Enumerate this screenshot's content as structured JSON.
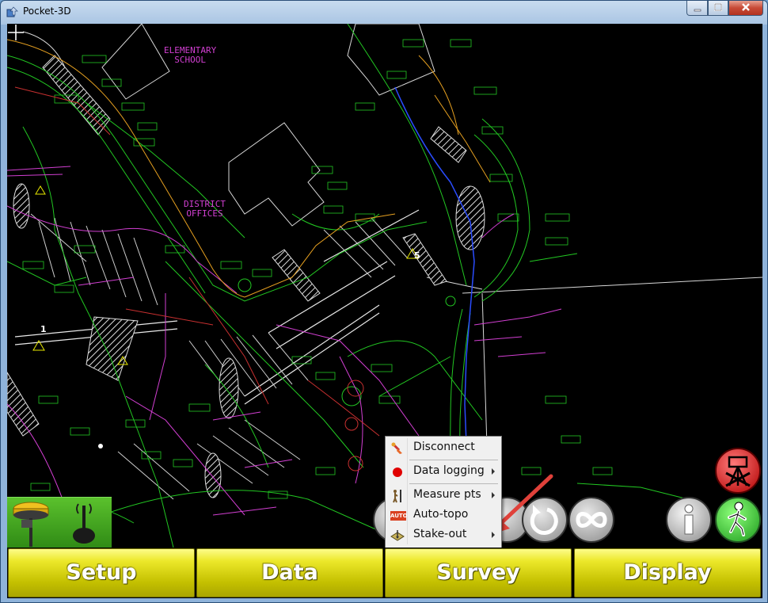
{
  "window": {
    "title": "Pocket-3D",
    "controls": [
      "minimize-icon",
      "maximize-icon",
      "close-icon"
    ]
  },
  "map": {
    "labels": {
      "school": [
        "ELEMENTARY",
        "SCHOOL"
      ],
      "offices": [
        "DISTRICT",
        "OFFICES"
      ],
      "point_1": "1",
      "point_5": "5"
    },
    "colors": {
      "background": "#000000",
      "green": "#22c722",
      "magenta": "#d23fd2",
      "orange": "#e6a020",
      "blue": "#2a4cff",
      "white": "#e8e8e8"
    }
  },
  "instrument_panel": {
    "icons": [
      "rover-receiver-icon",
      "base-antenna-icon"
    ]
  },
  "round_buttons": [
    {
      "name": "rotate-button",
      "icon": "rotate-icon"
    },
    {
      "name": "infinity-button",
      "icon": "infinity-icon"
    },
    {
      "name": "info-button",
      "icon": "info-icon"
    },
    {
      "name": "walk-mode-button",
      "icon": "walking-person-icon"
    },
    {
      "name": "disconnected-status-button",
      "icon": "no-tripod-icon"
    }
  ],
  "context_menu": {
    "items": [
      {
        "label": "Disconnect",
        "icon": "disconnect-icon",
        "submenu": false
      },
      {
        "label": "Data logging",
        "icon": "red-dot-icon",
        "submenu": true
      },
      {
        "label": "Measure pts",
        "icon": "measure-rod-icon",
        "submenu": true
      },
      {
        "label": "Auto-topo",
        "icon": "auto-icon",
        "submenu": false
      },
      {
        "label": "Stake-out",
        "icon": "stake-out-icon",
        "submenu": true
      }
    ],
    "auto_badge": "AUTO"
  },
  "bottom_tabs": [
    "Setup",
    "Data",
    "Survey",
    "Display"
  ],
  "annotation_arrow": {
    "color": "#e0413a",
    "points_to": "Stake-out"
  }
}
